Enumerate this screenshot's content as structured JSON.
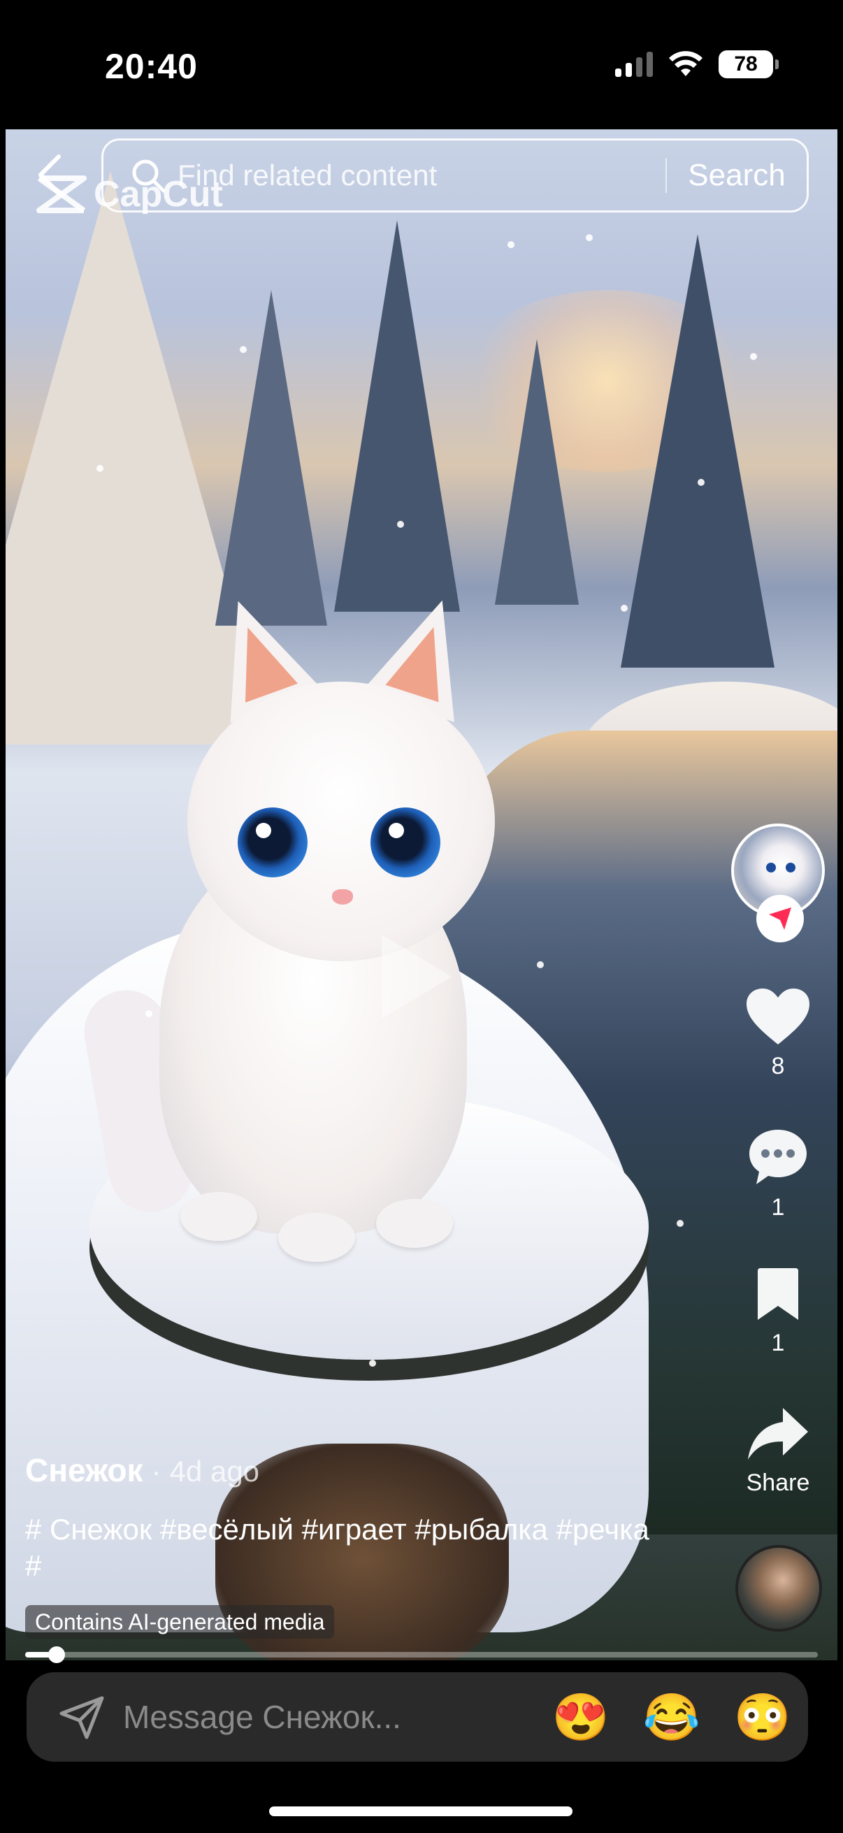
{
  "status_bar": {
    "time": "20:40",
    "battery": "78",
    "icons": [
      "cellular-signal-icon",
      "wifi-icon",
      "battery-icon"
    ]
  },
  "top_bar": {
    "back_icon": "chevron-left-icon",
    "watermark": "CapCut",
    "search_placeholder": "Find related content",
    "search_button": "Search"
  },
  "video": {
    "paused": true,
    "progress": 0.04
  },
  "actions": {
    "likes": "8",
    "comments": "1",
    "saves": "1",
    "share_label": "Share"
  },
  "caption": {
    "author": "Снежок",
    "separator": "·",
    "time_ago": "4d ago",
    "hashtags": "# Снежок #весёлый #играет #рыбалка #речка #",
    "ai_label": "Contains AI-generated media"
  },
  "message_bar": {
    "placeholder": "Message Снежок...",
    "emojis": [
      "😍",
      "😂",
      "😳"
    ]
  },
  "colors": {
    "accent_red": "#fe2c55",
    "bar_bg": "#2a2a2a"
  }
}
